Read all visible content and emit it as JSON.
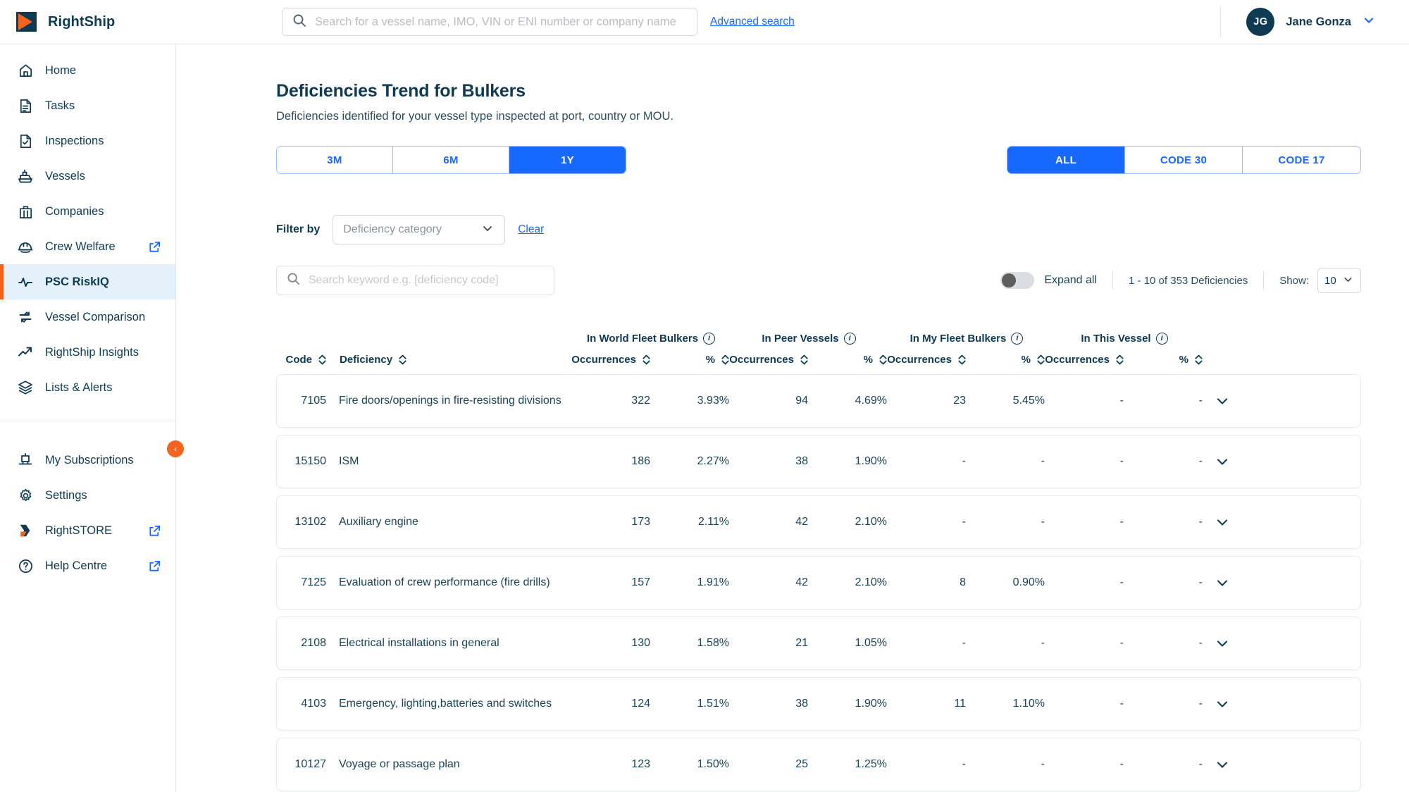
{
  "header": {
    "brand": "RightShip",
    "logo_colors": {
      "orange": "#F4641E",
      "navy": "#0E3A53"
    },
    "search": {
      "placeholder": "Search for a vessel name, IMO, VIN or ENI number or company name",
      "value": ""
    },
    "advanced_search": "Advanced search",
    "user": {
      "initials": "JG",
      "name": "Jane Gonza"
    }
  },
  "sidebar": {
    "items": [
      {
        "label": "Home",
        "icon": "home-icon",
        "external": false,
        "active": false
      },
      {
        "label": "Tasks",
        "icon": "tasks-document-icon",
        "external": false,
        "active": false
      },
      {
        "label": "Inspections",
        "icon": "inspections-check-document-icon",
        "external": false,
        "active": false
      },
      {
        "label": "Vessels",
        "icon": "vessel-ship-icon",
        "external": false,
        "active": false
      },
      {
        "label": "Companies",
        "icon": "companies-briefcase-icon",
        "external": false,
        "active": false
      },
      {
        "label": "Crew Welfare",
        "icon": "hard-hat-icon",
        "external": true,
        "active": false
      },
      {
        "label": "PSC RiskIQ",
        "icon": "pulse-activity-icon",
        "external": false,
        "active": true
      },
      {
        "label": "Vessel Comparison",
        "icon": "compare-arrows-icon",
        "external": false,
        "active": false
      },
      {
        "label": "RightShip Insights",
        "icon": "trend-arrow-icon",
        "external": false,
        "active": false
      },
      {
        "label": "Lists & Alerts",
        "icon": "layers-stack-icon",
        "external": false,
        "active": false
      }
    ],
    "items_bottom": [
      {
        "label": "My Subscriptions",
        "icon": "subscriptions-icon",
        "external": false,
        "active": false
      },
      {
        "label": "Settings",
        "icon": "gear-icon",
        "external": false,
        "active": false
      },
      {
        "label": "RightSTORE",
        "icon": "rightstore-logo-icon",
        "external": true,
        "active": false
      },
      {
        "label": "Help Centre",
        "icon": "help-question-icon",
        "external": true,
        "active": false
      }
    ],
    "collapse_glyph": "‹"
  },
  "main": {
    "title": "Deficiencies Trend for Bulkers",
    "subtitle": "Deficiencies identified for your vessel type inspected at port, country or MOU.",
    "period_tabs": [
      {
        "label": "3M",
        "active": false
      },
      {
        "label": "6M",
        "active": false
      },
      {
        "label": "1Y",
        "active": true
      }
    ],
    "code_tabs": [
      {
        "label": "ALL",
        "active": true
      },
      {
        "label": "CODE 30",
        "active": false
      },
      {
        "label": "CODE 17",
        "active": false
      }
    ],
    "filter": {
      "label": "Filter by",
      "select_value": "Deficiency category",
      "clear_label": "Clear"
    },
    "keyword_search": {
      "placeholder": "Search keyword e.g. [deficiency code]",
      "value": ""
    },
    "expand_all": {
      "label": "Expand all",
      "on": false
    },
    "pagination_summary": "1 - 10 of 353 Deficiencies",
    "show_label": "Show:",
    "show_value": "10",
    "accent_blue": "#1668FF",
    "accent_orange": "#F4641E",
    "navy": "#0E3A53"
  },
  "table": {
    "groups": [
      {
        "title": "In World Fleet Bulkers",
        "info": "i"
      },
      {
        "title": "In Peer Vessels",
        "info": "i"
      },
      {
        "title": "In My Fleet Bulkers",
        "info": "i"
      },
      {
        "title": "In This Vessel",
        "info": "i"
      }
    ],
    "columns": {
      "code": "Code",
      "deficiency": "Deficiency",
      "occurrences": "Occurrences",
      "percent": "%"
    },
    "rows": [
      {
        "code": "7105",
        "deficiency": "Fire doors/openings in fire-resisting divisions",
        "world_occ": "322",
        "world_pct": "3.93%",
        "peer_occ": "94",
        "peer_pct": "4.69%",
        "fleet_occ": "23",
        "fleet_pct": "5.45%",
        "vessel_occ": "-",
        "vessel_pct": "-"
      },
      {
        "code": "15150",
        "deficiency": "ISM",
        "world_occ": "186",
        "world_pct": "2.27%",
        "peer_occ": "38",
        "peer_pct": "1.90%",
        "fleet_occ": "-",
        "fleet_pct": "-",
        "vessel_occ": "-",
        "vessel_pct": "-"
      },
      {
        "code": "13102",
        "deficiency": "Auxiliary engine",
        "world_occ": "173",
        "world_pct": "2.11%",
        "peer_occ": "42",
        "peer_pct": "2.10%",
        "fleet_occ": "-",
        "fleet_pct": "-",
        "vessel_occ": "-",
        "vessel_pct": "-"
      },
      {
        "code": "7125",
        "deficiency": "Evaluation of crew performance (fire drills)",
        "world_occ": "157",
        "world_pct": "1.91%",
        "peer_occ": "42",
        "peer_pct": "2.10%",
        "fleet_occ": "8",
        "fleet_pct": "0.90%",
        "vessel_occ": "-",
        "vessel_pct": "-"
      },
      {
        "code": "2108",
        "deficiency": "Electrical installations in general",
        "world_occ": "130",
        "world_pct": "1.58%",
        "peer_occ": "21",
        "peer_pct": "1.05%",
        "fleet_occ": "-",
        "fleet_pct": "-",
        "vessel_occ": "-",
        "vessel_pct": "-"
      },
      {
        "code": "4103",
        "deficiency": "Emergency, lighting,batteries and switches",
        "world_occ": "124",
        "world_pct": "1.51%",
        "peer_occ": "38",
        "peer_pct": "1.90%",
        "fleet_occ": "11",
        "fleet_pct": "1.10%",
        "vessel_occ": "-",
        "vessel_pct": "-"
      },
      {
        "code": "10127",
        "deficiency": "Voyage or passage plan",
        "world_occ": "123",
        "world_pct": "1.50%",
        "peer_occ": "25",
        "peer_pct": "1.25%",
        "fleet_occ": "-",
        "fleet_pct": "-",
        "vessel_occ": "-",
        "vessel_pct": "-"
      }
    ]
  }
}
